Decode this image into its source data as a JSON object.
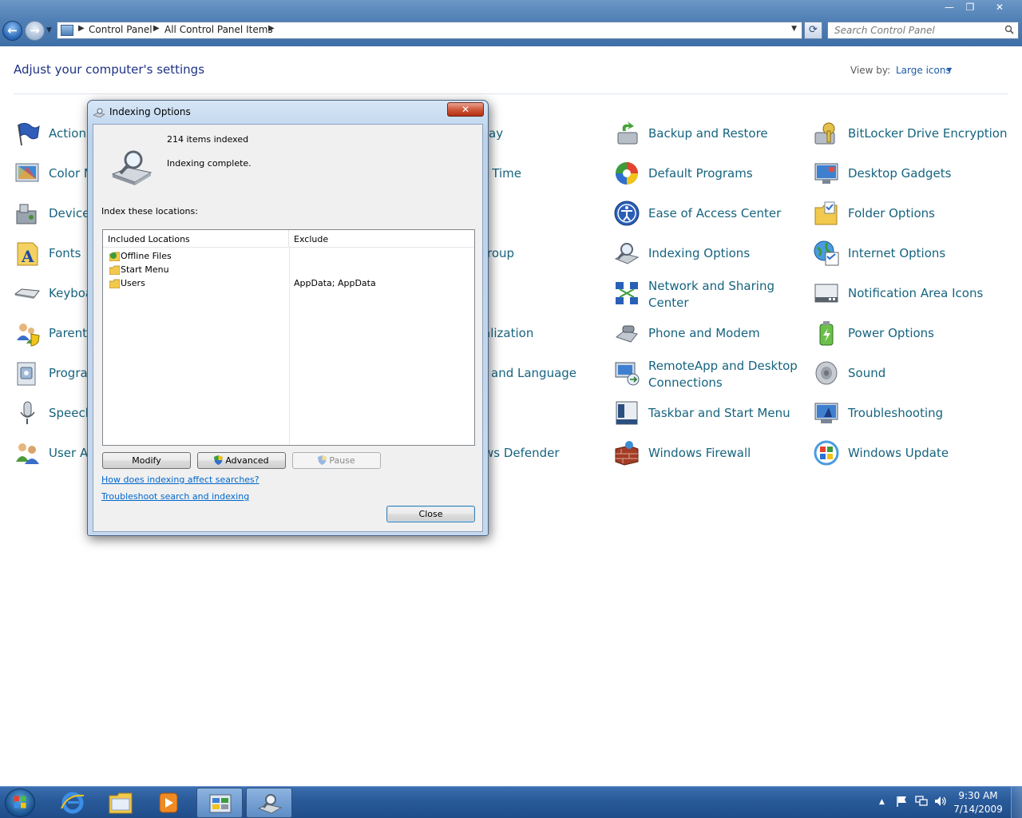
{
  "window": {
    "controls": {
      "minimize": "—",
      "maximize": "❐",
      "close": "✕"
    },
    "nav": {
      "back": "←",
      "forward": "→",
      "dropdown": "▼",
      "refresh": "⟳"
    },
    "address": {
      "crumbs": [
        "Control Panel",
        "All Control Panel Items"
      ],
      "separator": "▶",
      "dropdown_arrow": "▼"
    },
    "search": {
      "placeholder": "Search Control Panel",
      "icon": "search-icon"
    }
  },
  "control_panel": {
    "title": "Adjust your computer's settings",
    "view_by_label": "View by:",
    "view_by_value": "Large icons",
    "view_by_arrow": "▼",
    "columns": [
      [
        {
          "label": "Action Center",
          "icon": "flag-icon"
        },
        {
          "label": "Color Management",
          "icon": "color-management-icon"
        },
        {
          "label": "Device Manager",
          "icon": "device-manager-icon"
        },
        {
          "label": "Fonts",
          "icon": "fonts-icon"
        },
        {
          "label": "Keyboard",
          "icon": "keyboard-icon"
        },
        {
          "label": "Parental Controls",
          "icon": "parental-controls-icon"
        },
        {
          "label": "Programs and Features",
          "icon": "programs-icon"
        },
        {
          "label": "Speech Recognition",
          "icon": "microphone-icon"
        },
        {
          "label": "User Accounts",
          "icon": "users-icon"
        }
      ],
      [
        {
          "label": "Date and Time",
          "icon": "clock-icon"
        },
        {
          "label": "HomeGroup",
          "icon": "homegroup-icon"
        },
        {
          "label": "Personalization",
          "icon": "personalization-icon"
        },
        {
          "label": "Region and Language",
          "icon": "globe-icon"
        },
        {
          "label": "Windows Defender",
          "icon": "defender-icon"
        }
      ],
      [
        {
          "label": "Backup and Restore",
          "icon": "backup-icon"
        },
        {
          "label": "Default Programs",
          "icon": "default-programs-icon"
        },
        {
          "label": "Ease of Access Center",
          "icon": "ease-of-access-icon"
        },
        {
          "label": "Indexing Options",
          "icon": "indexing-icon"
        },
        {
          "label": "Network and Sharing Center",
          "line1": "Network and Sharing",
          "line2": "Center",
          "icon": "network-icon"
        },
        {
          "label": "Phone and Modem",
          "icon": "phone-icon"
        },
        {
          "label": "RemoteApp and Desktop Connections",
          "line1": "RemoteApp and Desktop",
          "line2": "Connections",
          "icon": "remoteapp-icon"
        },
        {
          "label": "Taskbar and Start Menu",
          "icon": "taskbar-icon"
        },
        {
          "label": "Windows Firewall",
          "icon": "firewall-icon"
        }
      ],
      [
        {
          "label": "BitLocker Drive Encryption",
          "icon": "bitlocker-icon"
        },
        {
          "label": "Desktop Gadgets",
          "icon": "gadgets-icon"
        },
        {
          "label": "Folder Options",
          "icon": "folder-options-icon"
        },
        {
          "label": "Internet Options",
          "icon": "internet-options-icon"
        },
        {
          "label": "Notification Area Icons",
          "icon": "notification-icon"
        },
        {
          "label": "Power Options",
          "icon": "power-icon"
        },
        {
          "label": "Sound",
          "icon": "speaker-icon"
        },
        {
          "label": "Troubleshooting",
          "icon": "troubleshooting-icon"
        },
        {
          "label": "Windows Update",
          "icon": "windows-update-icon"
        }
      ]
    ],
    "partial_labels": {
      "action": "Action",
      "color": "Color M",
      "device": "Device",
      "fonts": "Fonts",
      "keyboard": "Keyboa",
      "parental": "Parent",
      "programs": "Progra",
      "speech": "Speech",
      "user": "User A",
      "date_time_tail": "d Time",
      "ay_tail": "ay",
      "group_tail": "roup",
      "alization_tail": "alization",
      "language_tail": "and Language",
      "defender_tail": "ws Defender"
    }
  },
  "dialog": {
    "title": "Indexing Options",
    "close_glyph": "✕",
    "items_indexed": "214 items indexed",
    "status": "Indexing complete.",
    "locations_label": "Index these locations:",
    "columns": {
      "included": "Included Locations",
      "exclude": "Exclude"
    },
    "locations": [
      {
        "name": "Offline Files",
        "exclude": "",
        "icon": "offline-files-icon"
      },
      {
        "name": "Start Menu",
        "exclude": "",
        "icon": "folder-icon"
      },
      {
        "name": "Users",
        "exclude": "AppData; AppData",
        "icon": "folder-icon"
      }
    ],
    "buttons": {
      "modify": "Modify",
      "advanced": "Advanced",
      "pause": "Pause",
      "close": "Close"
    },
    "links": {
      "affect": "How does indexing affect searches?",
      "troubleshoot": "Troubleshoot search and indexing"
    }
  },
  "taskbar": {
    "buttons": [
      {
        "name": "internet-explorer",
        "icon": "ie-icon",
        "active": false
      },
      {
        "name": "windows-explorer",
        "icon": "explorer-folder-icon",
        "active": false
      },
      {
        "name": "media-player",
        "icon": "media-player-icon",
        "active": false
      },
      {
        "name": "control-panel",
        "icon": "control-panel-icon",
        "active": true
      },
      {
        "name": "indexing-options",
        "icon": "indexing-icon",
        "active": true
      }
    ],
    "tray": {
      "show_hidden": "▲"
    },
    "clock": {
      "time": "9:30 AM",
      "date": "7/14/2009"
    }
  },
  "colors": {
    "link": "#16647f",
    "title": "#1e3287",
    "taskbar": "#2a5b9a",
    "dialog_frame": "#c6d9ee"
  }
}
